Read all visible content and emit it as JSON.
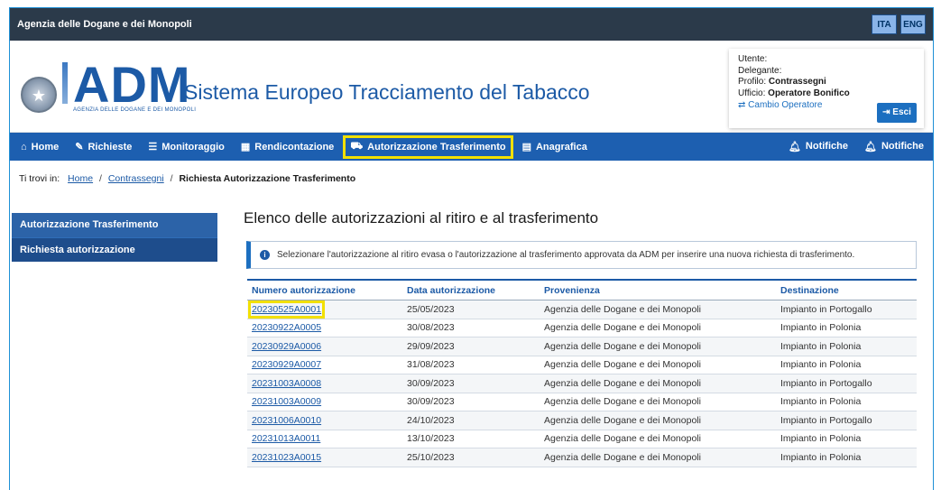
{
  "topbar": {
    "agency": "Agenzia delle Dogane e dei Monopoli",
    "lang_ita": "ITA",
    "lang_eng": "ENG"
  },
  "header": {
    "logo_text": "ADM",
    "logo_sub": "AGENZIA DELLE DOGANE E DEI MONOPOLI",
    "site_title": "Sistema Europeo Tracciamento del Tabacco"
  },
  "user": {
    "utente_label": "Utente:",
    "delegante_label": "Delegante:",
    "profilo_label": "Profilo:",
    "profilo_value": "Contrassegni",
    "ufficio_label": "Ufficio:",
    "ufficio_value": "Operatore Bonifico",
    "cambio": "Cambio Operatore",
    "esci": "Esci"
  },
  "nav": {
    "home": "Home",
    "richieste": "Richieste",
    "monitoraggio": "Monitoraggio",
    "rendicontazione": "Rendicontazione",
    "autorizzazione": "Autorizzazione Trasferimento",
    "anagrafica": "Anagrafica",
    "notifiche1": "Notifiche",
    "notifiche2": "Notifiche"
  },
  "breadcrumb": {
    "prefix": "Ti trovi in:",
    "home": "Home",
    "contrassegni": "Contrassegni",
    "current": "Richiesta Autorizzazione Trasferimento"
  },
  "sidebar": {
    "items": [
      {
        "label": "Autorizzazione Trasferimento"
      },
      {
        "label": "Richiesta autorizzazione"
      }
    ]
  },
  "main": {
    "title": "Elenco delle autorizzazioni al ritiro e al trasferimento",
    "info": "Selezionare l'autorizzazione al ritiro evasa o l'autorizzazione al trasferimento approvata da ADM per inserire una nuova richiesta di trasferimento."
  },
  "table": {
    "headers": [
      "Numero autorizzazione",
      "Data autorizzazione",
      "Provenienza",
      "Destinazione"
    ],
    "rows": [
      [
        "20230525A0001",
        "25/05/2023",
        "Agenzia delle Dogane e dei Monopoli",
        "Impianto in Portogallo"
      ],
      [
        "20230922A0005",
        "30/08/2023",
        "Agenzia delle Dogane e dei Monopoli",
        "Impianto in Polonia"
      ],
      [
        "20230929A0006",
        "29/09/2023",
        "Agenzia delle Dogane e dei Monopoli",
        "Impianto in Polonia"
      ],
      [
        "20230929A0007",
        "31/08/2023",
        "Agenzia delle Dogane e dei Monopoli",
        "Impianto in Polonia"
      ],
      [
        "20231003A0008",
        "30/09/2023",
        "Agenzia delle Dogane e dei Monopoli",
        "Impianto in Portogallo"
      ],
      [
        "20231003A0009",
        "30/09/2023",
        "Agenzia delle Dogane e dei Monopoli",
        "Impianto in Polonia"
      ],
      [
        "20231006A0010",
        "24/10/2023",
        "Agenzia delle Dogane e dei Monopoli",
        "Impianto in Portogallo"
      ],
      [
        "20231013A0011",
        "13/10/2023",
        "Agenzia delle Dogane e dei Monopoli",
        "Impianto in Polonia"
      ],
      [
        "20231023A0015",
        "25/10/2023",
        "Agenzia delle Dogane e dei Monopoli",
        "Impianto in Polonia"
      ]
    ]
  },
  "colors": {
    "nav_bg": "#1d5fb0",
    "topbar_bg": "#2b3a4a",
    "highlight": "#f2e000",
    "link": "#1c5aa6"
  }
}
